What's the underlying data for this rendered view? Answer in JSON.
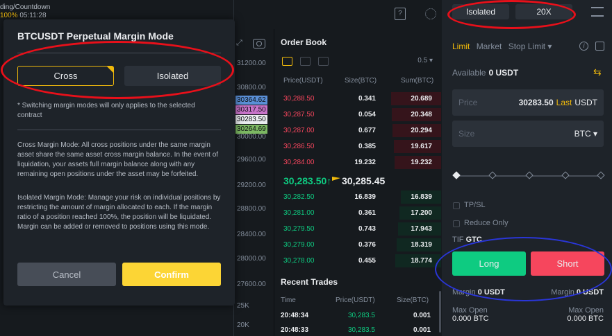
{
  "topbar": {
    "countdown_label": "ding/Countdown",
    "countdown_pct": "100%",
    "countdown_time": "05:11:28",
    "help_icon": "?"
  },
  "chart": {
    "y_ticks": [
      "31200.00",
      "30800.00",
      "30364.62",
      "30317.50",
      "30283.50",
      "30264.69",
      "30000.00",
      "29600.00",
      "29200.00",
      "28800.00",
      "28400.00",
      "28000.00",
      "27600.00",
      "25K",
      "20K"
    ],
    "tag_colors": [
      "#5a8fd6",
      "#c874c9",
      "#eaecef",
      "#7cb862"
    ]
  },
  "modal": {
    "title": "BTCUSDT Perpetual Margin Mode",
    "cross_label": "Cross",
    "isolated_label": "Isolated",
    "note": "* Switching margin modes will only applies to the selected contract",
    "cross_desc": "Cross Margin Mode: All cross positions under the same margin asset share the same asset cross margin balance. In the event of liquidation, your assets full margin balance along with any remaining open positions under the asset may be forfeited.",
    "isolated_desc": "Isolated Margin Mode: Manage your risk on individual positions by restricting the amount of margin allocated to each. If the margin ratio of a position reached 100%, the position will be liquidated. Margin can be added or removed to positions using this mode.",
    "cancel_label": "Cancel",
    "confirm_label": "Confirm"
  },
  "orderbook": {
    "title": "Order Book",
    "precision": "0.5 ▾",
    "headers": [
      "Price(USDT)",
      "Size(BTC)",
      "Sum(BTC)"
    ],
    "asks": [
      {
        "price": "30,288.50",
        "size": "0.341",
        "sum": "20.689"
      },
      {
        "price": "30,287.50",
        "size": "0.054",
        "sum": "20.348"
      },
      {
        "price": "30,287.00",
        "size": "0.677",
        "sum": "20.294"
      },
      {
        "price": "30,286.50",
        "size": "0.385",
        "sum": "19.617"
      },
      {
        "price": "30,284.00",
        "size": "19.232",
        "sum": "19.232"
      }
    ],
    "last_price": "30,283.50↑",
    "mark_price": "30,285.45",
    "bids": [
      {
        "price": "30,282.50",
        "size": "16.839",
        "sum": "16.839"
      },
      {
        "price": "30,281.00",
        "size": "0.361",
        "sum": "17.200"
      },
      {
        "price": "30,279.50",
        "size": "0.743",
        "sum": "17.943"
      },
      {
        "price": "30,279.00",
        "size": "0.376",
        "sum": "18.319"
      },
      {
        "price": "30,278.00",
        "size": "0.455",
        "sum": "18.774"
      }
    ]
  },
  "recent_trades": {
    "title": "Recent Trades",
    "headers": [
      "Time",
      "Price(USDT)",
      "Size(BTC)"
    ],
    "rows": [
      {
        "time": "20:48:34",
        "price": "30,283.5",
        "size": "0.001"
      },
      {
        "time": "20:48:33",
        "price": "30,283.5",
        "size": "0.001"
      }
    ]
  },
  "panel": {
    "margin_mode": "Isolated",
    "leverage": "20X",
    "tabs": [
      "Limit",
      "Market",
      "Stop Limit ▾"
    ],
    "info_icon": "i",
    "available_label": "Available",
    "available_value": "0 USDT",
    "swap_icon": "⇆",
    "price_label": "Price",
    "price_value": "30283.50",
    "price_last": "Last",
    "price_unit": "USDT",
    "size_label": "Size",
    "size_unit": "BTC ▾",
    "tpsl_label": "TP/SL",
    "reduce_label": "Reduce Only",
    "tif_label": "TIF",
    "tif_value": "GTC",
    "long_label": "Long",
    "short_label": "Short",
    "margin_label": "Margin",
    "margin_left": "0 USDT",
    "margin_right": "0 USDT",
    "maxopen_label": "Max Open",
    "maxopen_left": "0.000 BTC",
    "maxopen_right": "0.000 BTC"
  },
  "annotations": {
    "red": "#e8101a",
    "blue": "#2a36d8"
  }
}
